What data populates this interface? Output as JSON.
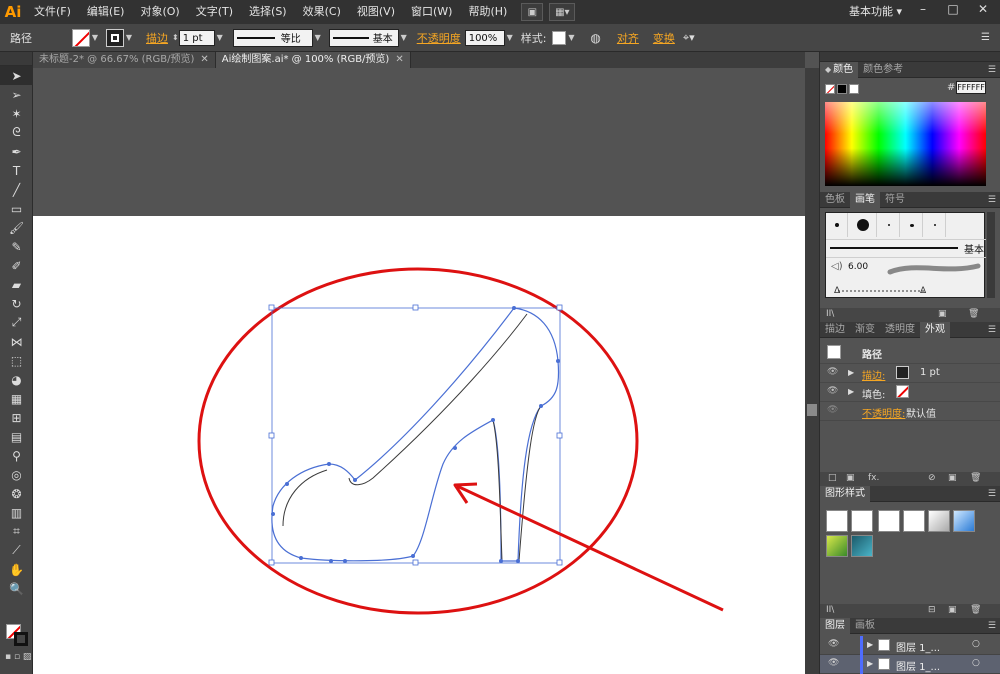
{
  "app": {
    "logo": "Ai",
    "workspace": "基本功能"
  },
  "menu": {
    "items": [
      "文件(F)",
      "编辑(E)",
      "对象(O)",
      "文字(T)",
      "选择(S)",
      "效果(C)",
      "视图(V)",
      "窗口(W)",
      "帮助(H)"
    ]
  },
  "window_controls": {
    "minimize": "–",
    "maximize": "□",
    "close": "✕"
  },
  "control_bar": {
    "selection": "路径",
    "stroke_link": "描边",
    "stroke_weight": "1 pt",
    "stroke_profile": "等比",
    "brush": "基本",
    "opacity_link": "不透明度",
    "opacity_value": "100%",
    "style_label": "样式:",
    "align_link": "对齐",
    "transform_link": "变换"
  },
  "tabs": [
    {
      "label": "未标题-2* @ 66.67% (RGB/预览)",
      "active": false
    },
    {
      "label": "Ai绘制图案.ai* @ 100% (RGB/预览)",
      "active": true
    }
  ],
  "tools": [
    "selection-arrow",
    "direct-selection",
    "magic-wand",
    "lasso",
    "pen",
    "type",
    "line-segment",
    "rectangle",
    "paintbrush",
    "pencil",
    "blob-brush",
    "eraser",
    "rotate",
    "scale",
    "width",
    "free-transform",
    "shape-builder",
    "perspective-grid",
    "mesh",
    "gradient",
    "eyedropper",
    "blend",
    "symbol-sprayer",
    "column-graph",
    "artboard",
    "slice",
    "hand",
    "zoom"
  ],
  "color_panel": {
    "tabs": [
      "颜色",
      "颜色参考"
    ],
    "hash": "#",
    "hex": "FFFFFF"
  },
  "brush_panel": {
    "tabs": [
      "色板",
      "画笔",
      "符号"
    ],
    "basic_label": "基本",
    "size_value": "6.00"
  },
  "appearance_panel": {
    "tabs": [
      "描边",
      "渐变",
      "透明度",
      "外观"
    ],
    "title": "路径",
    "stroke_label": "描边:",
    "stroke_value": "1 pt",
    "fill_label": "填色:",
    "opacity_label": "不透明度:",
    "opacity_value": "默认值",
    "fx": "fx."
  },
  "graphic_styles_panel": {
    "tabs": [
      "图形样式"
    ]
  },
  "layers_panel": {
    "tabs": [
      "图层",
      "画板"
    ],
    "layers": [
      "图层 1_...",
      "图层 1_..."
    ]
  },
  "colors": {
    "accent_link": "#f5a623",
    "annotation_red": "#dd1111",
    "path_blue": "#4a6fd4",
    "path_dark": "#3a3a3a"
  }
}
